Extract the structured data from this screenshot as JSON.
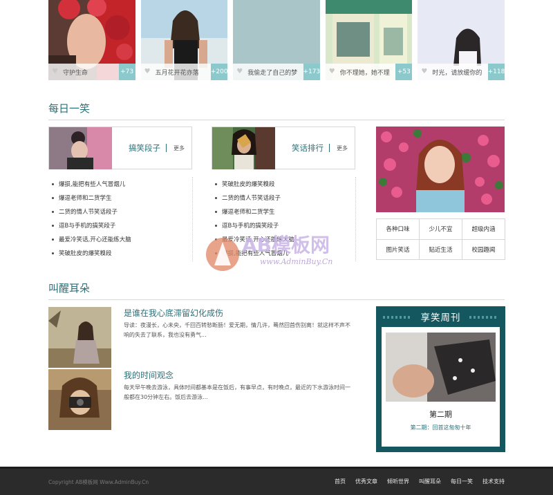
{
  "gallery": [
    {
      "caption": "守护生命",
      "count": "+73"
    },
    {
      "caption": "五月花开花亦落",
      "count": "+200"
    },
    {
      "caption": "我偷走了自己的梦",
      "count": "+173"
    },
    {
      "caption": "你不理她，她不理",
      "count": "+53"
    },
    {
      "caption": "时光，请放缓你的",
      "count": "+118"
    }
  ],
  "sections": {
    "daily": "每日一笑",
    "wake": "叫醒耳朵"
  },
  "joke_boxes": [
    {
      "title": "搞笑段子",
      "more": "更多"
    },
    {
      "title": "笑话排行",
      "more": "更多"
    }
  ],
  "joke_lists": [
    [
      "爆损,能把有些人气冒烟儿",
      "爆逗老师和二货学生",
      "二货的情人节笑话段子",
      "逗B与手机的搞笑段子",
      "最爱冷笑话,开心还能练大脑",
      "笑破肚皮的爆笑糗段"
    ],
    [
      "笑破肚皮的爆笑糗段",
      "二货的情人节笑话段子",
      "爆逗老师和二货学生",
      "逗B与手机的搞笑段子",
      "最爱冷笑话,开心还能练大脑",
      "爆损,能把有些人气冒烟儿"
    ]
  ],
  "tags": [
    "各种口味",
    "少儿不宜",
    "超级内涵",
    "图片笑话",
    "贴近生活",
    "校园趣闻"
  ],
  "watermark": {
    "big": "AB模板网",
    "small": "www.AdminBuy.Cn"
  },
  "articles": [
    {
      "title": "是谁在我心底滞留幻化成伤",
      "text": "导读：夜漫长，心未央，千回百转愁断肠！爱无期，情几许，蓦然回首伤别离！就这样不声不响的失去了联系，我也没有勇气..."
    },
    {
      "title": "我的时间观念",
      "text": "每天早午晚去游泳，具体时间都基本是在饭后，有事早点，有时晚点，最近的下水游泳时间一般都在30分钟左右。饭后去游泳..."
    }
  ],
  "magazine": {
    "title": "享笑周刊",
    "issue": "第二期",
    "subtitle": "第二期：回首这匆匆十年"
  },
  "footer": {
    "copyright": "Copyright AB模板网 Www.AdminBuy.Cn",
    "nav": [
      "首页",
      "优秀文章",
      "倾听世界",
      "叫醒耳朵",
      "每日一笑",
      "技术支持"
    ]
  }
}
